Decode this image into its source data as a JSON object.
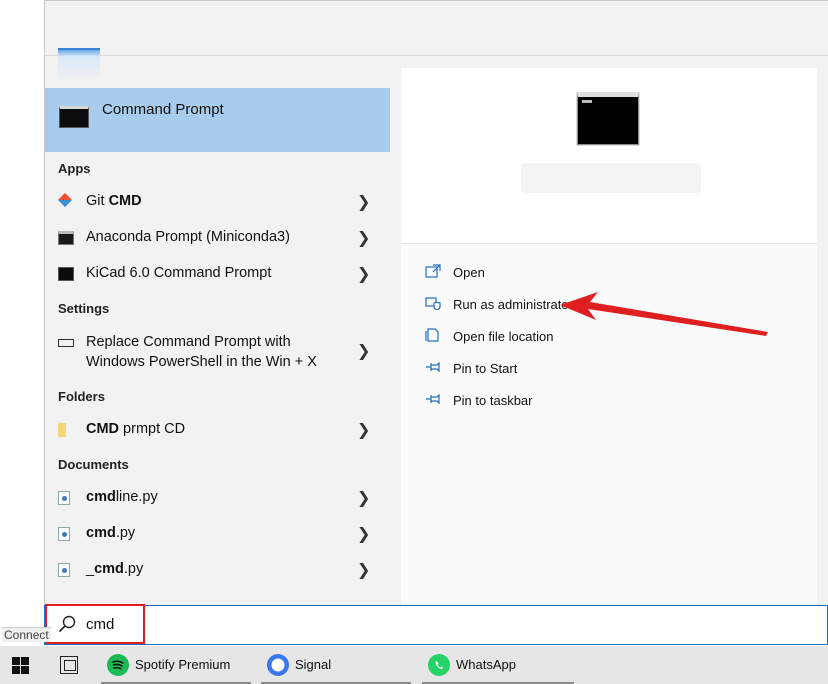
{
  "best_match": {
    "label": "Command Prompt"
  },
  "sections": {
    "apps": "Apps",
    "settings": "Settings",
    "folders": "Folders",
    "documents": "Documents"
  },
  "apps": [
    {
      "prefix": "Git ",
      "bold": "CMD",
      "suffix": "",
      "icon": "git-icon"
    },
    {
      "prefix": "Anaconda Prompt (Miniconda3)",
      "bold": "",
      "suffix": "",
      "icon": "terminal-icon"
    },
    {
      "prefix": "KiCad 6.0 Command Prompt",
      "bold": "",
      "suffix": "",
      "icon": "terminal-icon"
    }
  ],
  "settings": [
    {
      "line1": "Replace Command Prompt with",
      "line2": "Windows PowerShell in the Win + X",
      "icon": "settings-keyboard-icon"
    }
  ],
  "folders": [
    {
      "prefix": "",
      "bold": "CMD",
      "suffix": " prmpt CD",
      "icon": "folder-icon"
    }
  ],
  "documents": [
    {
      "prefix": "",
      "bold": "cmd",
      "suffix": "line.py",
      "icon": "python-file-icon"
    },
    {
      "prefix": "",
      "bold": "cmd",
      "suffix": ".py",
      "icon": "python-file-icon"
    },
    {
      "prefix": "_",
      "bold": "cmd",
      "suffix": ".py",
      "icon": "python-file-icon"
    }
  ],
  "actions": [
    {
      "label": "Open",
      "icon": "open-icon"
    },
    {
      "label": "Run as administrator",
      "icon": "shield-icon"
    },
    {
      "label": "Open file location",
      "icon": "file-location-icon"
    },
    {
      "label": "Pin to Start",
      "icon": "pin-icon"
    },
    {
      "label": "Pin to taskbar",
      "icon": "pin-icon"
    }
  ],
  "search": {
    "query": "cmd"
  },
  "status_text": "Connect",
  "taskbar": {
    "apps": [
      {
        "label": "Spotify Premium",
        "color": "#1db954"
      },
      {
        "label": "Signal",
        "color": "#3a76f0"
      },
      {
        "label": "WhatsApp",
        "color": "#25d366"
      }
    ]
  },
  "colors": {
    "highlight": "#a8cdec",
    "accent": "#1f6fc5",
    "annotation": "#e02020"
  }
}
